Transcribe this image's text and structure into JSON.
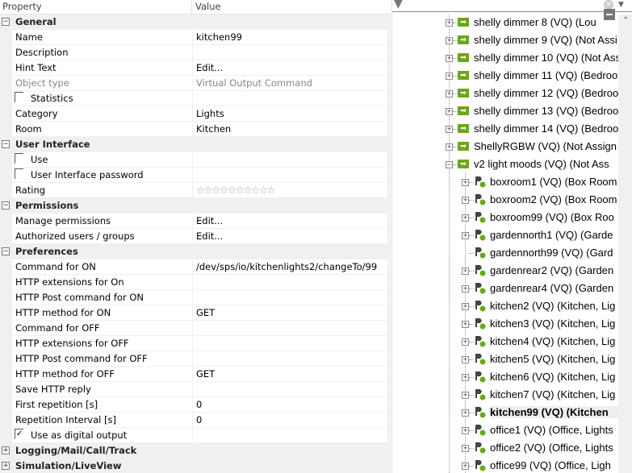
{
  "grid": {
    "header": {
      "property": "Property",
      "value": "Value"
    },
    "sections": [
      {
        "label": "General",
        "expanded": true,
        "rows": [
          {
            "name": "Name",
            "value": "kitchen99"
          },
          {
            "name": "Description",
            "value": ""
          },
          {
            "name": "Hint Text",
            "value": "Edit..."
          },
          {
            "name": "Object type",
            "value": "Virtual Output Command",
            "disabled": true
          },
          {
            "name": "Statistics",
            "checkbox": true,
            "checked": false
          },
          {
            "name": "Category",
            "value": "Lights"
          },
          {
            "name": "Room",
            "value": "Kitchen"
          }
        ]
      },
      {
        "label": "User Interface",
        "expanded": true,
        "rows": [
          {
            "name": "Use",
            "checkbox": true,
            "checked": false
          },
          {
            "name": "User Interface password",
            "checkbox": true,
            "checked": false
          },
          {
            "name": "Rating",
            "rating": 0,
            "rating_max": 10
          }
        ]
      },
      {
        "label": "Permissions",
        "expanded": true,
        "rows": [
          {
            "name": "Manage permissions",
            "value": "Edit..."
          },
          {
            "name": "Authorized users / groups",
            "value": "Edit..."
          }
        ]
      },
      {
        "label": "Preferences",
        "expanded": true,
        "rows": [
          {
            "name": "Command for ON",
            "value": "/dev/sps/io/kitchenlights2/changeTo/99"
          },
          {
            "name": "HTTP extensions for On",
            "value": ""
          },
          {
            "name": "HTTP Post command for ON",
            "value": ""
          },
          {
            "name": "HTTP method for ON",
            "value": "GET"
          },
          {
            "name": "Command for OFF",
            "value": ""
          },
          {
            "name": "HTTP extensions for OFF",
            "value": ""
          },
          {
            "name": "HTTP Post command for OFF",
            "value": ""
          },
          {
            "name": "HTTP method for OFF",
            "value": "GET"
          },
          {
            "name": "Save HTTP reply",
            "value": ""
          },
          {
            "name": "First repetition [s]",
            "value": "0"
          },
          {
            "name": "Repetition Interval [s]",
            "value": "0"
          },
          {
            "name": "Use as digital output",
            "checkbox": true,
            "checked": true
          }
        ]
      },
      {
        "label": "Logging/Mail/Call/Track",
        "expanded": false,
        "rows": []
      },
      {
        "label": "Simulation/LiveView",
        "expanded": false,
        "rows": []
      }
    ]
  },
  "tree": {
    "items": [
      {
        "text": "shelly dimmer 8 (VQ) (Lou",
        "level": 0,
        "icon": "virtual-output-icon",
        "toggle": "+"
      },
      {
        "text": "shelly dimmer 9 (VQ) (Not Assi",
        "level": 0,
        "icon": "virtual-output-icon",
        "toggle": "+"
      },
      {
        "text": "shelly dimmer 10 (VQ) (Not Ass",
        "level": 0,
        "icon": "virtual-output-icon",
        "toggle": "+"
      },
      {
        "text": "shelly dimmer 11 (VQ) (Bedroo",
        "level": 0,
        "icon": "virtual-output-icon",
        "toggle": "+"
      },
      {
        "text": "shelly dimmer 12 (VQ) (Bedroo",
        "level": 0,
        "icon": "virtual-output-icon",
        "toggle": "+"
      },
      {
        "text": "shelly dimmer 13 (VQ) (Bedroo",
        "level": 0,
        "icon": "virtual-output-icon",
        "toggle": "+"
      },
      {
        "text": "shelly dimmer 14 (VQ) (Bedroo",
        "level": 0,
        "icon": "virtual-output-icon",
        "toggle": "+"
      },
      {
        "text": "ShellyRGBW (VQ) (Not Assign",
        "level": 0,
        "icon": "virtual-output-icon",
        "toggle": "+"
      },
      {
        "text": "v2 light moods (VQ) (Not Ass",
        "level": 0,
        "icon": "virtual-output-icon",
        "toggle": "-"
      },
      {
        "text": "boxroom1 (VQ) (Box Room",
        "level": 1,
        "icon": "command-icon",
        "toggle": "+"
      },
      {
        "text": "boxroom2 (VQ) (Box Room",
        "level": 1,
        "icon": "command-icon",
        "toggle": "+"
      },
      {
        "text": "boxroom99 (VQ) (Box Roo",
        "level": 1,
        "icon": "command-icon",
        "toggle": "+"
      },
      {
        "text": "gardennorth1 (VQ) (Garde",
        "level": 1,
        "icon": "command-icon",
        "toggle": "+"
      },
      {
        "text": "gardennorth99 (VQ) (Gard",
        "level": 1,
        "icon": "command-icon",
        "toggle": ""
      },
      {
        "text": "gardenrear2 (VQ) (Garden",
        "level": 1,
        "icon": "command-icon",
        "toggle": "+"
      },
      {
        "text": "gardenrear4 (VQ) (Garden",
        "level": 1,
        "icon": "command-icon",
        "toggle": "+"
      },
      {
        "text": "kitchen2 (VQ) (Kitchen, Lig",
        "level": 1,
        "icon": "command-icon",
        "toggle": "+"
      },
      {
        "text": "kitchen3 (VQ) (Kitchen, Lig",
        "level": 1,
        "icon": "command-icon",
        "toggle": "+"
      },
      {
        "text": "kitchen4 (VQ) (Kitchen, Lig",
        "level": 1,
        "icon": "command-icon",
        "toggle": "+"
      },
      {
        "text": "kitchen5 (VQ) (Kitchen, Lig",
        "level": 1,
        "icon": "command-icon",
        "toggle": "+"
      },
      {
        "text": "kitchen6 (VQ) (Kitchen, Lig",
        "level": 1,
        "icon": "command-icon",
        "toggle": "+"
      },
      {
        "text": "kitchen7 (VQ) (Kitchen, Lig",
        "level": 1,
        "icon": "command-icon",
        "toggle": "+"
      },
      {
        "text": "kitchen99 (VQ) (Kitchen",
        "level": 1,
        "icon": "command-icon",
        "toggle": "+",
        "selected": true
      },
      {
        "text": "office1 (VQ) (Office, Lights",
        "level": 1,
        "icon": "command-icon",
        "toggle": "+"
      },
      {
        "text": "office2 (VQ) (Office, Lights",
        "level": 1,
        "icon": "command-icon",
        "toggle": "+"
      },
      {
        "text": "office99 (VQ) (Office, Ligh",
        "level": 1,
        "icon": "command-icon",
        "toggle": "+"
      }
    ]
  },
  "colors": {
    "icon_green": "#6aa818",
    "selection": "#eeeeee"
  }
}
